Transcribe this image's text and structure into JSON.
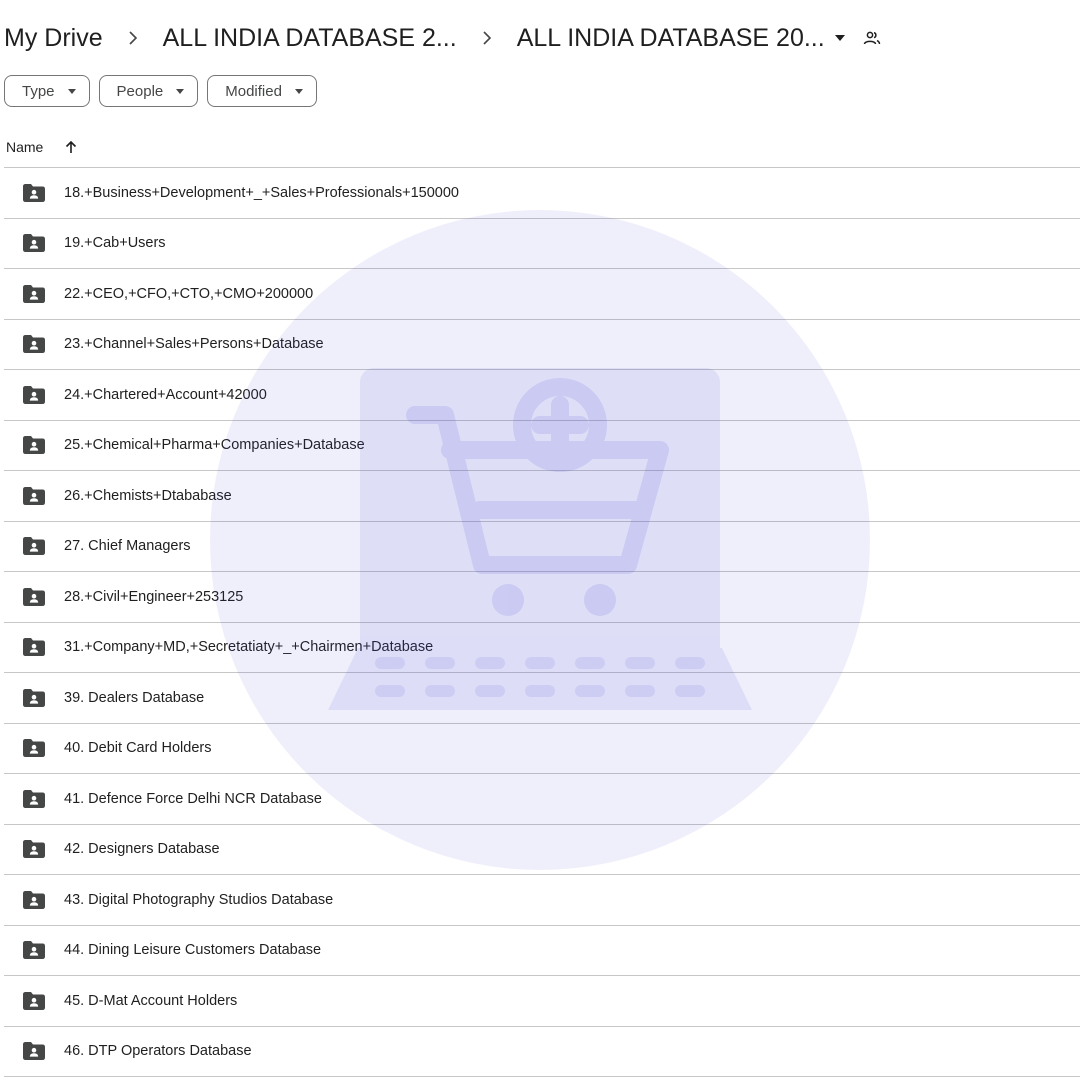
{
  "breadcrumb": {
    "root": "My Drive",
    "parent": "ALL INDIA DATABASE 2...",
    "current": "ALL INDIA DATABASE 20..."
  },
  "filters": [
    "Type",
    "People",
    "Modified"
  ],
  "header": {
    "name_label": "Name",
    "sort": "ascending"
  },
  "folders": [
    "18.+Business+Development+_+Sales+Professionals+150000",
    "19.+Cab+Users",
    "22.+CEO,+CFO,+CTO,+CMO+200000",
    "23.+Channel+Sales+Persons+Database",
    "24.+Chartered+Account+42000",
    "25.+Chemical+Pharma+Companies+Database",
    "26.+Chemists+Dtababase",
    "27. Chief Managers",
    "28.+Civil+Engineer+253125",
    "31.+Company+MD,+Secretatiaty+_+Chairmen+Database",
    "39. Dealers Database",
    "40. Debit Card Holders",
    "41. Defence Force Delhi NCR Database",
    "42. Designers Database",
    "43. Digital Photography Studios Database",
    "44. Dining Leisure Customers Database",
    "45. D-Mat Account Holders",
    "46. DTP Operators Database"
  ],
  "colors": {
    "text": "#1f1f1f",
    "icon": "#444746",
    "divider": "#c7c7c7",
    "watermark": "#4a4ad6"
  }
}
